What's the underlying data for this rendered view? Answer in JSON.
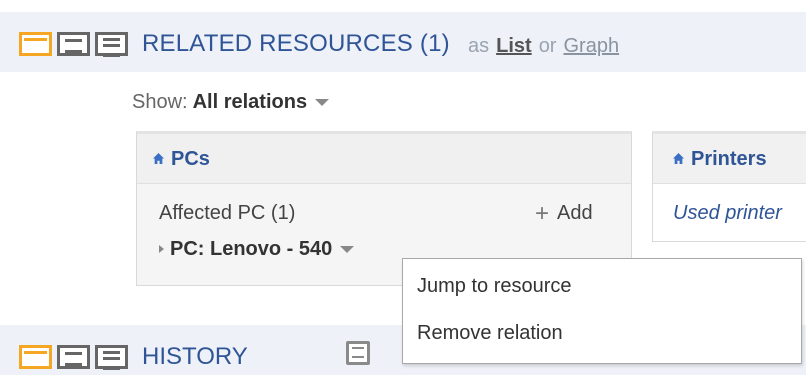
{
  "related": {
    "title": "RELATED RESOURCES (1)",
    "as_text": "as",
    "list_link": "List",
    "or_text": "or",
    "graph_link": "Graph"
  },
  "show": {
    "label": "Show:",
    "value": "All relations"
  },
  "pcs_card": {
    "title": "PCs",
    "relation_label": "Affected PC (1)",
    "add_label": "Add",
    "add_symbol": "+",
    "item_label": "PC: Lenovo - 540"
  },
  "printers_card": {
    "title": "Printers",
    "relation_label": "Used printer"
  },
  "context_menu": {
    "items": [
      "Jump to resource",
      "Remove relation"
    ]
  },
  "history": {
    "title": "HISTORY"
  },
  "colors": {
    "accent_orange": "#f5a623",
    "title_blue": "#2f5597",
    "bar_background": "#eef1f7"
  },
  "icons": [
    "tile-view-icon",
    "split-view-icon",
    "list-view-icon",
    "home-icon",
    "caret-down-icon",
    "triangle-right-icon",
    "plus-icon",
    "note-icon"
  ]
}
